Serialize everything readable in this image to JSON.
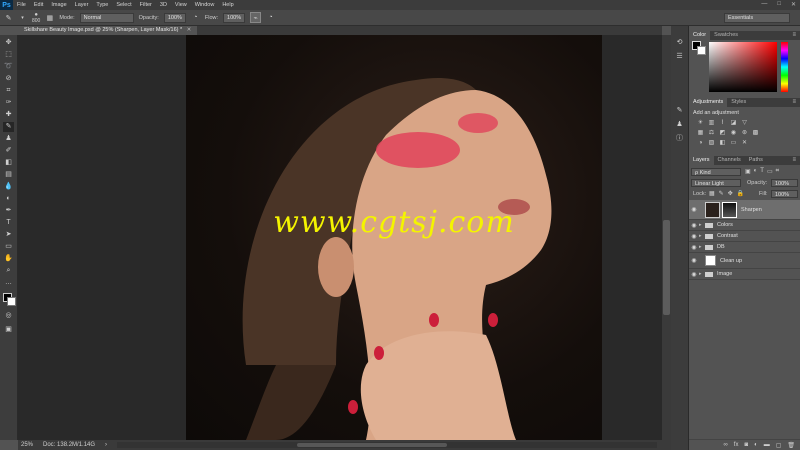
{
  "app": {
    "logo": "Ps"
  },
  "menu": [
    "File",
    "Edit",
    "Image",
    "Layer",
    "Type",
    "Select",
    "Filter",
    "3D",
    "View",
    "Window",
    "Help"
  ],
  "window_controls": {
    "minimize": "—",
    "maximize": "□",
    "close": "✕"
  },
  "options": {
    "brush_size": "800",
    "mode_label": "Mode:",
    "mode_value": "Normal",
    "opacity_label": "Opacity:",
    "opacity_value": "100%",
    "flow_label": "Flow:",
    "flow_value": "100%",
    "workspace": "Essentials"
  },
  "document": {
    "tab_title": "Skillshare Beauty Image.psd @ 25% (Sharpen, Layer Mask/16) *",
    "watermark": "www.cgtsj.com"
  },
  "status": {
    "zoom": "25%",
    "doc_info": "Doc: 138.2M/1.14G",
    "arrow": "›"
  },
  "panels": {
    "color_tabs": [
      "Color",
      "Swatches"
    ],
    "adjust_tabs": [
      "Adjustments",
      "Styles"
    ],
    "adjust_title": "Add an adjustment",
    "layer_tabs": [
      "Layers",
      "Channels",
      "Paths"
    ],
    "kind_label": "ρ Kind",
    "blend_mode": "Linear Light",
    "opacity_label": "Opacity:",
    "opacity_value": "100%",
    "lock_label": "Lock:",
    "fill_label": "Fill:",
    "fill_value": "100%"
  },
  "layers": [
    {
      "name": "Sharpen",
      "type": "masked",
      "selected": true
    },
    {
      "name": "Colors",
      "type": "group",
      "selected": false
    },
    {
      "name": "Contrast",
      "type": "group",
      "selected": false
    },
    {
      "name": "DB",
      "type": "group",
      "selected": false
    },
    {
      "name": "Clean up",
      "type": "pixel",
      "selected": false
    },
    {
      "name": "Image",
      "type": "group",
      "selected": false
    }
  ],
  "colors": {
    "accent": "#31a8ff",
    "watermark": "#f4f400",
    "panel_bg": "#535353",
    "canvas_bg": "#292929"
  }
}
